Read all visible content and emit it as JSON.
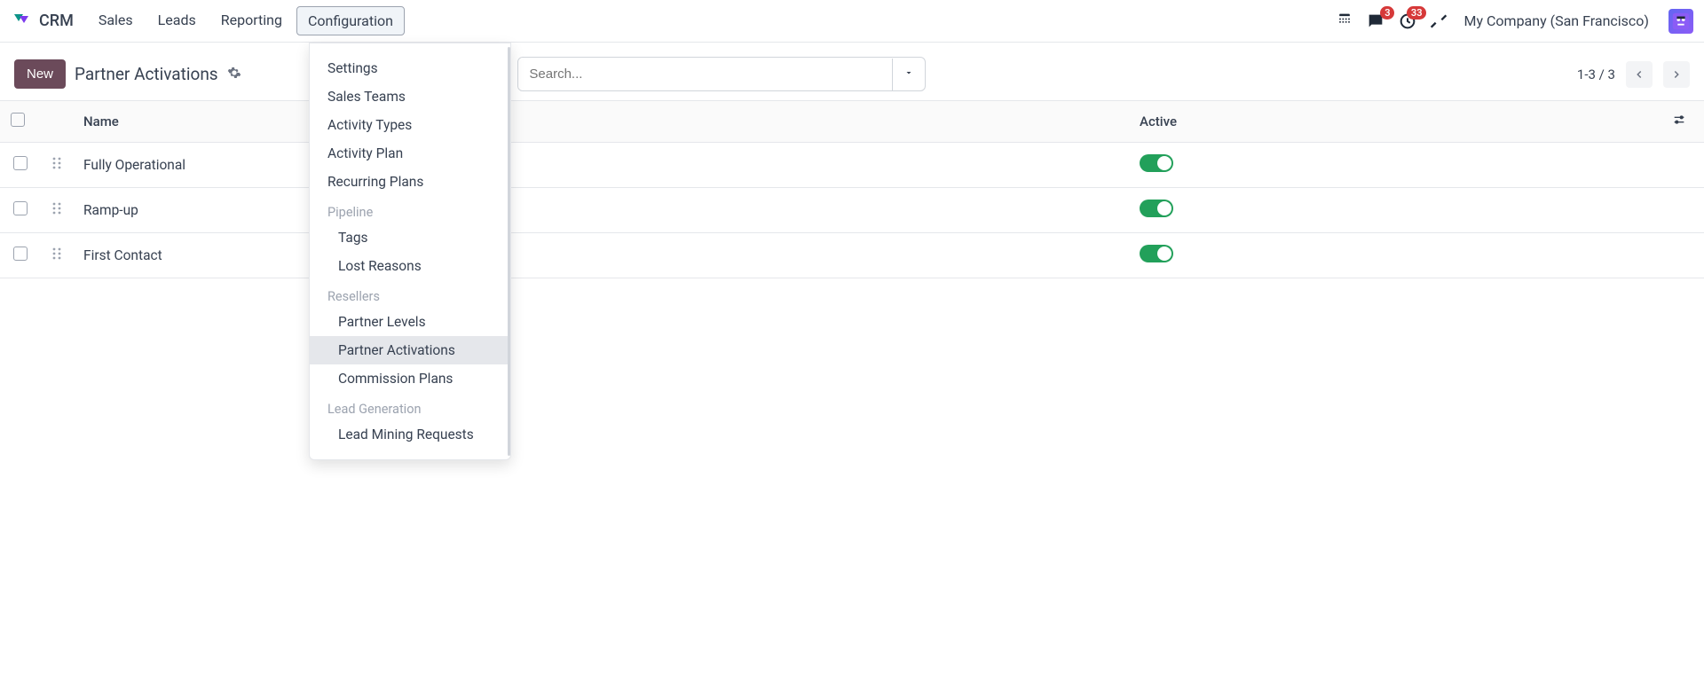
{
  "brand": "CRM",
  "nav": [
    "Sales",
    "Leads",
    "Reporting",
    "Configuration"
  ],
  "nav_active_index": 3,
  "badges": {
    "chat": "3",
    "clock": "33"
  },
  "company": "My Company (San Francisco)",
  "subhead": {
    "new_label": "New",
    "title": "Partner Activations",
    "search_placeholder": "Search...",
    "pager_text": "1-3 / 3"
  },
  "dropdown": {
    "items": [
      {
        "label": "Settings",
        "type": "item"
      },
      {
        "label": "Sales Teams",
        "type": "item"
      },
      {
        "label": "Activity Types",
        "type": "item"
      },
      {
        "label": "Activity Plan",
        "type": "item"
      },
      {
        "label": "Recurring Plans",
        "type": "item"
      },
      {
        "label": "Pipeline",
        "type": "header"
      },
      {
        "label": "Tags",
        "type": "sub"
      },
      {
        "label": "Lost Reasons",
        "type": "sub"
      },
      {
        "label": "Resellers",
        "type": "header"
      },
      {
        "label": "Partner Levels",
        "type": "sub"
      },
      {
        "label": "Partner Activations",
        "type": "sub",
        "selected": true
      },
      {
        "label": "Commission Plans",
        "type": "sub"
      },
      {
        "label": "Lead Generation",
        "type": "header"
      },
      {
        "label": "Lead Mining Requests",
        "type": "sub"
      }
    ]
  },
  "table": {
    "columns": {
      "name": "Name",
      "active": "Active"
    },
    "rows": [
      {
        "name": "Fully Operational",
        "active": true
      },
      {
        "name": "Ramp-up",
        "active": true
      },
      {
        "name": "First Contact",
        "active": true
      }
    ]
  }
}
